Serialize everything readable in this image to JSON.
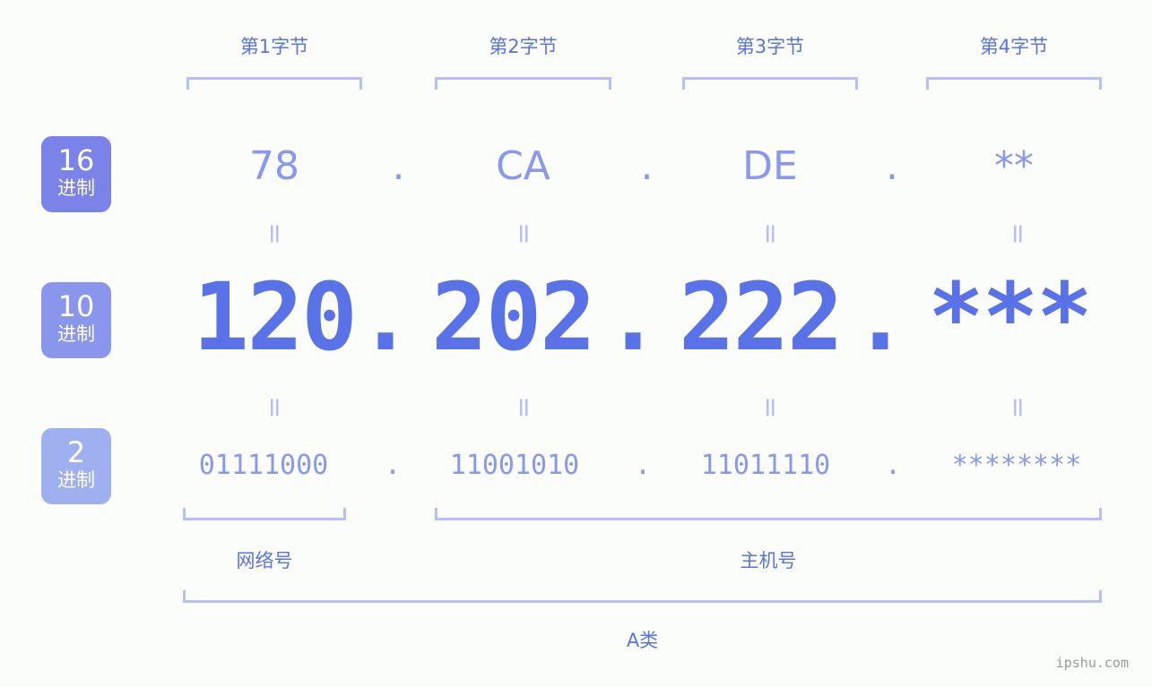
{
  "background_color": "#fbfdfa",
  "accent_color": "#5a72e8",
  "light_accent_color": "#8897f0",
  "bracket_color": "#b6bffa",
  "byte_headers": [
    {
      "label": "第1字节"
    },
    {
      "label": "第2字节"
    },
    {
      "label": "第3字节"
    },
    {
      "label": "第4字节"
    }
  ],
  "radix_badges": [
    {
      "number": "16",
      "unit": "进制",
      "color": "#7b82e8"
    },
    {
      "number": "10",
      "unit": "进制",
      "color": "#8a96ec"
    },
    {
      "number": "2",
      "unit": "进制",
      "color": "#9fb0f0"
    }
  ],
  "rows": {
    "hex": {
      "octets": [
        "78",
        "CA",
        "DE",
        "**"
      ],
      "separator": "."
    },
    "decimal": {
      "octets": [
        "120",
        "202",
        "222",
        "***"
      ],
      "separator": "."
    },
    "binary": {
      "octets": [
        "01111000",
        "11001010",
        "11011110",
        "********"
      ],
      "separator": "."
    }
  },
  "equals_symbol": "=",
  "sections": {
    "network": {
      "label": "网络号"
    },
    "host": {
      "label": "主机号"
    },
    "class": {
      "label": "A类"
    }
  },
  "watermark": "ipshu.com"
}
